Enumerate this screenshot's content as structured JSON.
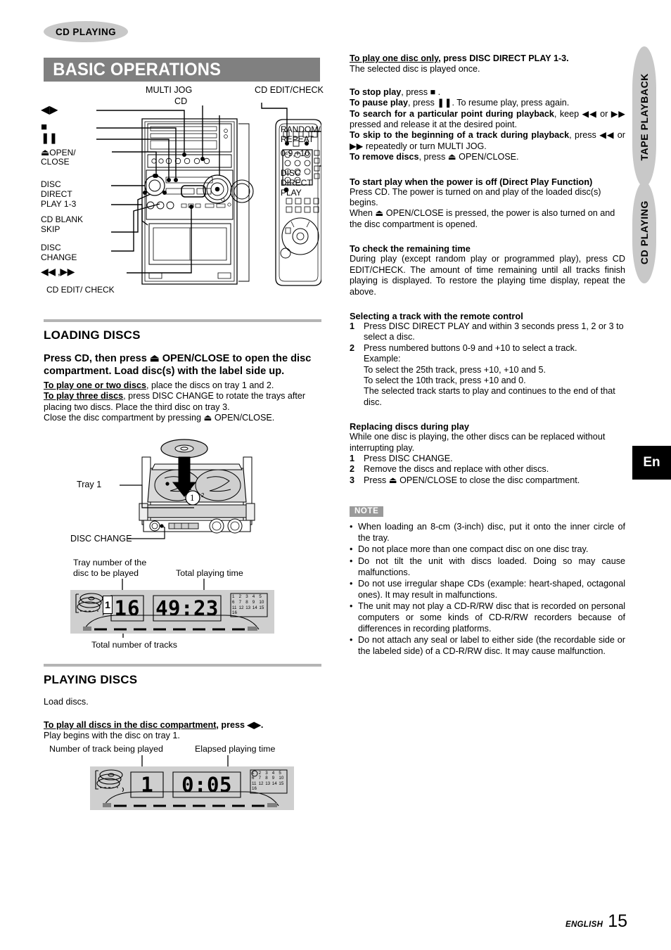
{
  "running_head": "CD PLAYING",
  "title": "BASIC OPERATIONS",
  "side_tabs": [
    {
      "label": "TAPE PLAYBACK"
    },
    {
      "label": "CD PLAYING"
    }
  ],
  "lang_box": "En",
  "footer": {
    "language": "ENGLISH",
    "page": "15"
  },
  "figure_main": {
    "labels_left": [
      "◀▶",
      "■",
      "❚❚",
      "⏏ OPEN/\nCLOSE",
      "DISC\nDIRECT\nPLAY 1-3",
      "CD BLANK\nSKIP",
      "DISC\nCHANGE",
      "◀◀ ,▶▶",
      "CD EDIT/ CHECK"
    ],
    "label_play_pause": "◀▶",
    "label_stop": "■",
    "label_pause": "❚❚",
    "label_open_close": "OPEN/",
    "label_open_close2": "CLOSE",
    "label_disc_direct_1": "DISC",
    "label_disc_direct_2": "DIRECT",
    "label_disc_direct_3": "PLAY 1-3",
    "label_blank_1": "CD BLANK",
    "label_blank_2": "SKIP",
    "label_change_1": "DISC",
    "label_change_2": "CHANGE",
    "label_skip": "◀◀ ,▶▶",
    "label_editcheck_bottom": "CD EDIT/ CHECK",
    "label_multijog": "MULTI JOG",
    "label_cd": "CD",
    "label_editcheck_top": "CD EDIT/CHECK",
    "label_random_1": "RANDOM/",
    "label_random_2": "REPEAT",
    "label_numeric": "0-9,+10",
    "label_ddp_1": "DISC",
    "label_ddp_2": "DIRECT",
    "label_ddp_3": "PLAY"
  },
  "loading": {
    "heading": "LOADING DISCS",
    "intro_bold": "Press CD, then press ⏏ OPEN/CLOSE to open the disc compartment.  Load disc(s) with the label side up.",
    "lines": [
      {
        "lead": "To play one or two discs",
        "rest": ", place the discs on tray 1 and 2."
      },
      {
        "lead": "To play three discs",
        "rest": ", press DISC CHANGE to rotate the trays after placing two discs. Place the third disc on tray 3."
      }
    ],
    "close_line": "Close the disc compartment by pressing ⏏ OPEN/CLOSE.",
    "figure": {
      "tray_label": "Tray 1",
      "disc_change_label": "DISC CHANGE",
      "tray_number_mark": "1",
      "tray_number_mark2": "2"
    },
    "display": {
      "caption_tray_1": "Tray number of the",
      "caption_tray_2": "disc to be played",
      "caption_total_time": "Total playing time",
      "caption_total_tracks": "Total number of tracks",
      "value_tray": "1",
      "value_tracks": "16",
      "value_time": "49:23",
      "track_grid": [
        "1",
        "2",
        "3",
        "4",
        "5",
        "6",
        "7",
        "8",
        "9",
        "10",
        "11",
        "12",
        "13",
        "14",
        "15",
        "16"
      ]
    }
  },
  "playing": {
    "heading": "PLAYING DISCS",
    "load_line": "Load discs.",
    "all_discs_lead": "To play all discs in the disc compartment",
    "all_discs_rest": ", press ◀▶.",
    "begin_line": "Play begins with the disc on tray 1.",
    "display": {
      "caption_track": "Number of track being played",
      "caption_elapsed": "Elapsed playing time",
      "value_track": "1",
      "value_time": "0:05",
      "track_grid": [
        "1",
        "2",
        "3",
        "4",
        "5",
        "6",
        "7",
        "8",
        "9",
        "10",
        "11",
        "12",
        "13",
        "14",
        "15",
        "16"
      ]
    }
  },
  "right": {
    "one_disc_lead": "To play one disc only",
    "one_disc_rest": ", press DISC DIRECT PLAY 1-3.",
    "one_disc_sub": "The selected disc is played once.",
    "ops": [
      {
        "lead": "To stop play",
        "rest": ", press ■ ."
      },
      {
        "lead": "To pause play",
        "rest": ", press ❚❚. To resume play, press again."
      },
      {
        "lead": "To search for a particular point during playback",
        "rest": ", keep ◀◀ or ▶▶ pressed and release it at the desired point."
      },
      {
        "lead": "To skip to the beginning of a track during playback",
        "rest": ", press ◀◀ or ▶▶ repeatedly or turn MULTI JOG."
      },
      {
        "lead": "To remove discs",
        "rest": ", press ⏏ OPEN/CLOSE."
      }
    ],
    "direct_play": {
      "heading": "To start play when the power is off (Direct Play Function)",
      "p1": "Press CD.  The power is turned on and play of the loaded disc(s) begins.",
      "p2": "When ⏏ OPEN/CLOSE is pressed, the power is also turned on and the disc compartment is opened."
    },
    "remaining": {
      "heading": "To check the remaining time",
      "body": "During play (except random play or programmed play), press CD EDIT/CHECK. The amount of time remaining until all tracks finish playing is displayed. To restore the playing time display, repeat the above."
    },
    "selecting": {
      "heading": "Selecting a track with the remote control",
      "steps": [
        {
          "num": "1",
          "text": "Press DISC DIRECT PLAY and within 3 seconds press 1, 2 or 3 to select a disc."
        },
        {
          "num": "2",
          "text": "Press numbered buttons 0-9 and +10 to select a track."
        }
      ],
      "example_label": "Example:",
      "example_lines": [
        "To select the 25th track, press +10, +10 and 5.",
        "To select the 10th track, press +10 and 0.",
        "The selected track starts to play and continues to the end of that disc."
      ]
    },
    "replacing": {
      "heading": "Replacing discs during play",
      "intro": "While one disc is playing, the other discs can be replaced without interrupting play.",
      "steps": [
        {
          "num": "1",
          "text": "Press DISC CHANGE."
        },
        {
          "num": "2",
          "text": "Remove the discs and replace with other discs."
        },
        {
          "num": "3",
          "text": "Press ⏏ OPEN/CLOSE to close the disc compartment."
        }
      ]
    },
    "note": {
      "badge": "NOTE",
      "items": [
        "When loading an 8-cm (3-inch) disc, put it onto the inner circle of the tray.",
        "Do not place more than one compact disc on one disc tray.",
        "Do not tilt the unit with discs loaded. Doing so may cause malfunctions.",
        "Do not use irregular shape CDs (example: heart-shaped, octagonal ones). It may result in malfunctions.",
        "The unit may not play a CD-R/RW disc that is recorded on personal computers or some kinds of CD-R/RW recorders because of differences in recording platforms.",
        "Do not attach any seal or label to either side (the recordable side or the labeled side) of a CD-R/RW disc. It may cause malfunction."
      ]
    }
  },
  "colors": {
    "title_bar": "#808080",
    "runhead_bg": "#c8c8c8",
    "rule": "#b4b4b4",
    "display_bg": "#cfcfcf",
    "note_badge": "#9a9a9a"
  }
}
